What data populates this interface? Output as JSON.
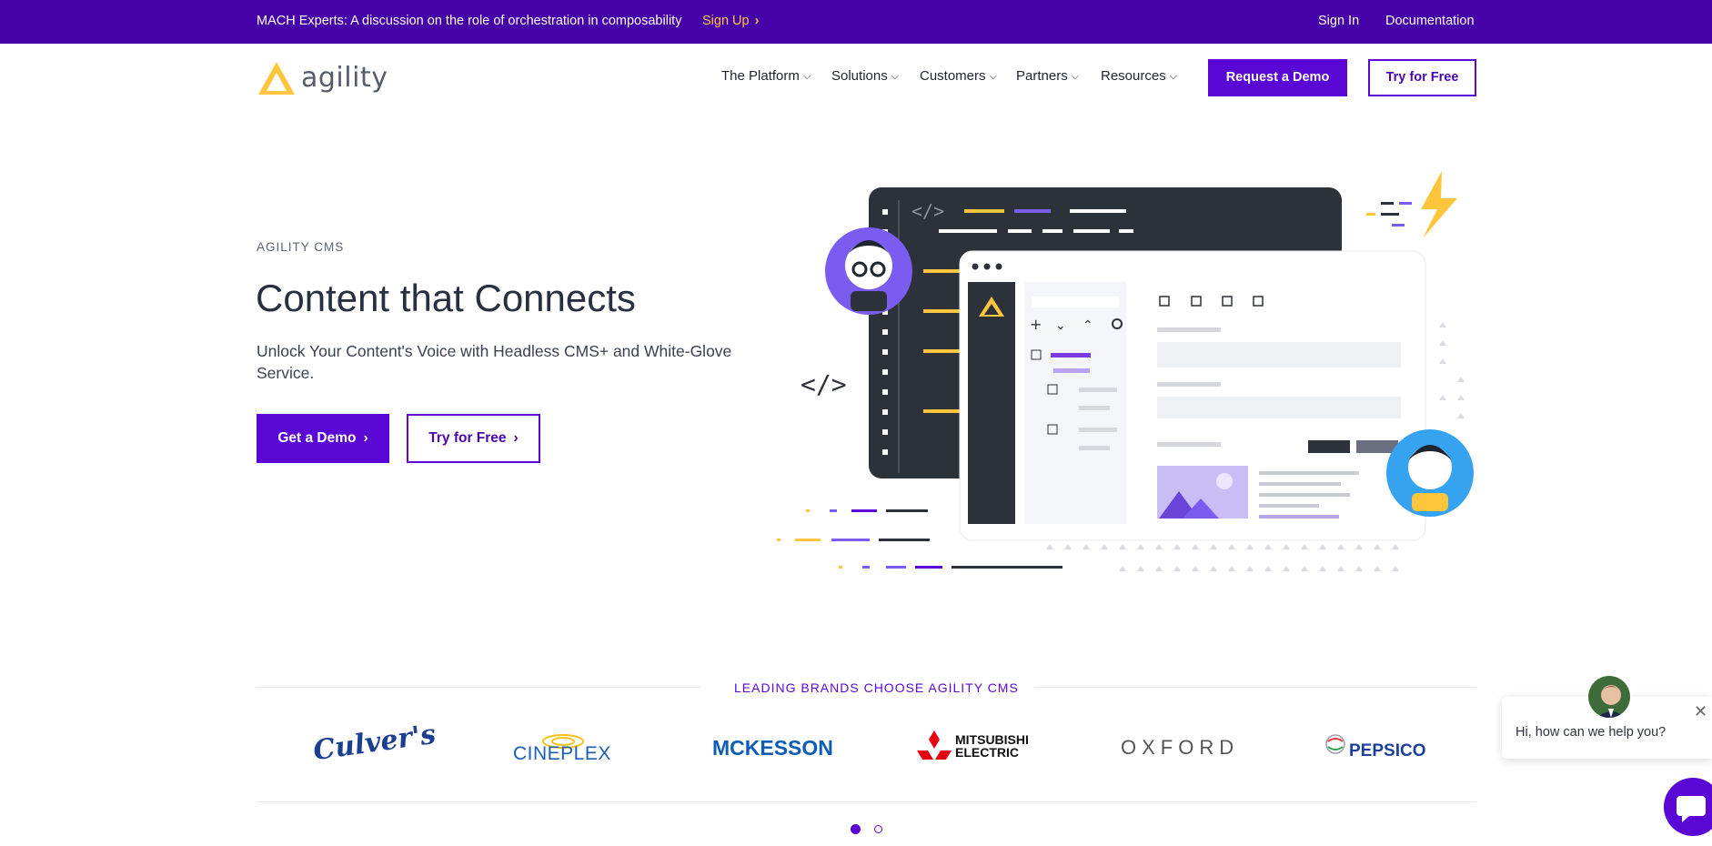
{
  "topbar": {
    "message": "MACH Experts: A discussion on the role of orchestration in composability",
    "signup_label": "Sign Up",
    "signin_label": "Sign In",
    "docs_label": "Documentation"
  },
  "header": {
    "logo_text": "agility",
    "nav": [
      {
        "label": "The Platform"
      },
      {
        "label": "Solutions"
      },
      {
        "label": "Customers"
      },
      {
        "label": "Partners"
      },
      {
        "label": "Resources"
      }
    ],
    "request_demo_label": "Request a Demo",
    "try_free_label": "Try for Free"
  },
  "hero": {
    "eyebrow": "AGILITY CMS",
    "title": "Content that Connects",
    "subtitle": "Unlock Your Content's Voice with Headless CMS+ and White-Glove Service.",
    "demo_button": "Get a Demo",
    "try_button": "Try for Free"
  },
  "brands": {
    "title": "LEADING BRANDS CHOOSE AGILITY CMS",
    "logos": [
      {
        "name": "Culver's",
        "color": "#1b3f8f"
      },
      {
        "name": "CINEPLEX",
        "color": "#1f5fb0"
      },
      {
        "name": "MCKESSON",
        "color": "#0b5db5"
      },
      {
        "name": "MITSUBISHI",
        "sub": "ELECTRIC",
        "color": "#111111"
      },
      {
        "name": "OXFORD",
        "color": "#555555"
      },
      {
        "name": "PEPSICO",
        "color": "#1c3f9e"
      }
    ],
    "carousel_pages": 2,
    "carousel_active": 1
  },
  "chat": {
    "message": "Hi, how can we help you?",
    "close_icon": "close-icon",
    "launcher_icon": "chat-bubble-icon"
  },
  "colors": {
    "brand_purple": "#5a06d4",
    "topbar_purple": "#4600a8",
    "accent_yellow": "#ffc53d"
  }
}
